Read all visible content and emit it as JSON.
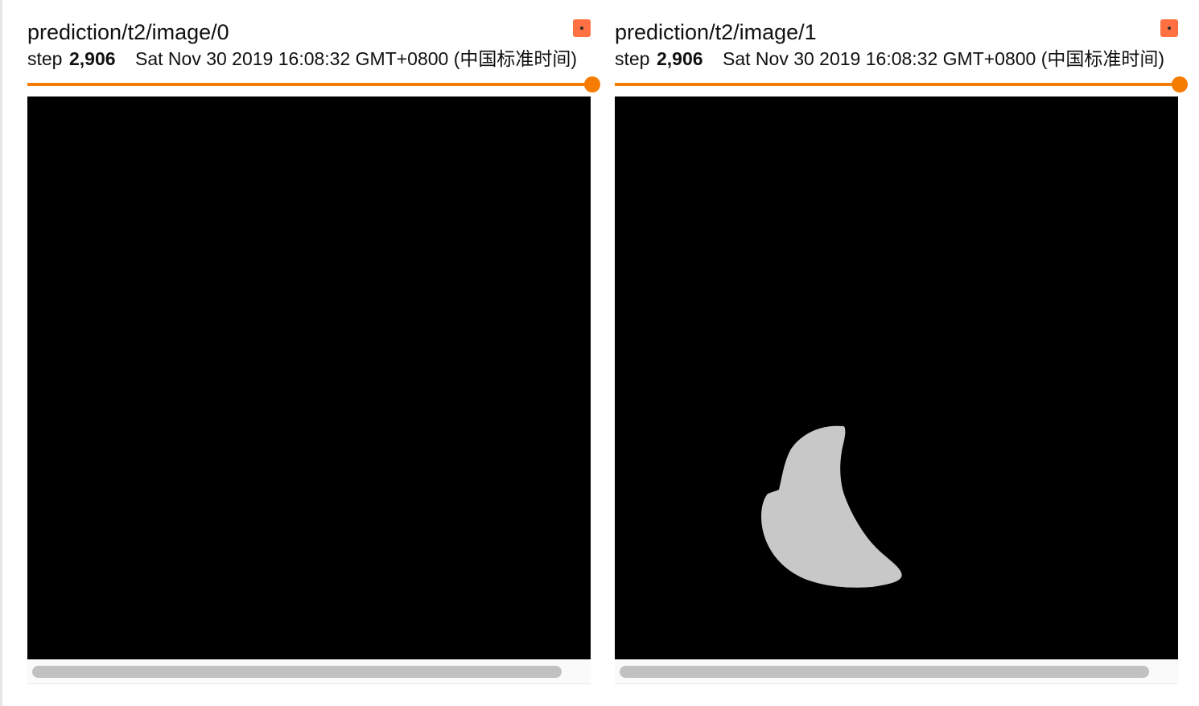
{
  "colors": {
    "accent": "#f57c00",
    "expand_button": "#ff7043",
    "image_background": "#000000",
    "mask_fill": "#c8c8c8"
  },
  "cards": [
    {
      "title": "prediction/t2/image/0",
      "step_label": "step",
      "step_value": "2,906",
      "timestamp": "Sat Nov 30 2019 16:08:32 GMT+0800 (中国标准时间)",
      "slider_level": 1.0,
      "has_mask": false,
      "expand_icon": "expand-icon"
    },
    {
      "title": "prediction/t2/image/1",
      "step_label": "step",
      "step_value": "2,906",
      "timestamp": "Sat Nov 30 2019 16:08:32 GMT+0800 (中国标准时间)",
      "slider_level": 1.0,
      "has_mask": true,
      "expand_icon": "expand-icon"
    }
  ]
}
